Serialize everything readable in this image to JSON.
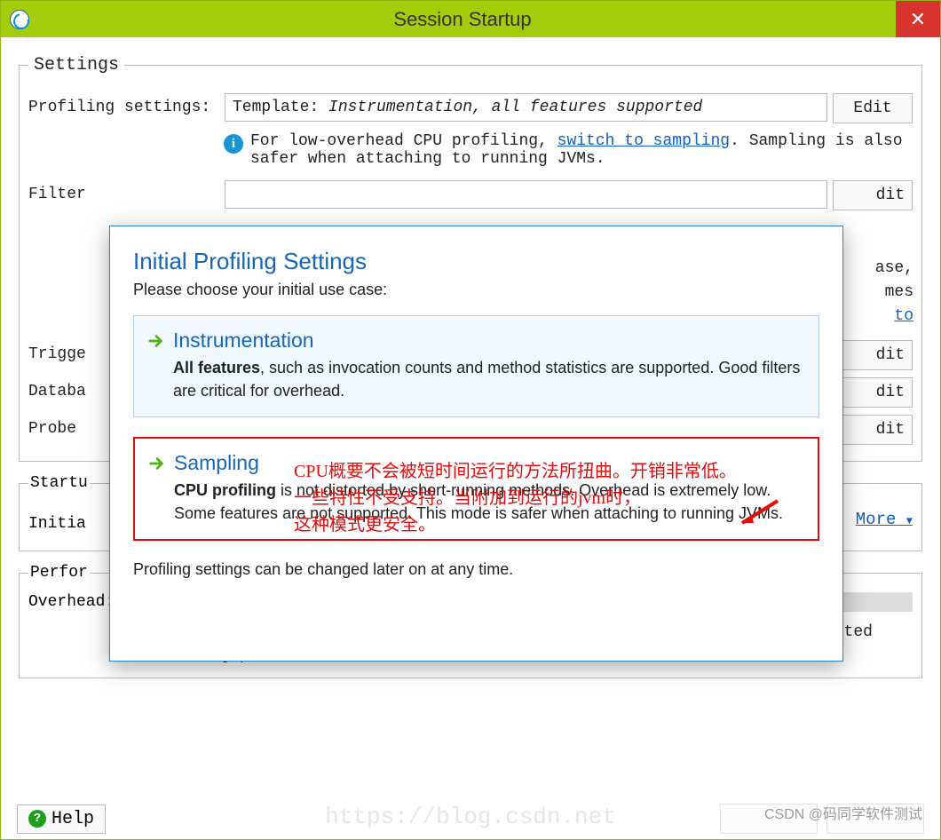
{
  "titlebar": {
    "title": "Session Startup",
    "close": "✕"
  },
  "settings": {
    "legend": "Settings",
    "rows": {
      "profiling": {
        "label": "Profiling settings:",
        "value_prefix": "Template: ",
        "value_italic": "Instrumentation, all features supported",
        "button": "Edit"
      },
      "info": {
        "pre": "For low-overhead CPU profiling, ",
        "link": "switch to sampling",
        "post": ". Sampling is also safer when attaching to running JVMs."
      },
      "filter": {
        "label": "Filter",
        "button_tail": "dit"
      },
      "filter_tail": {
        "line1_tail": "ase,",
        "line2_tail": "mes",
        "link_tail": " to"
      },
      "trigger": {
        "label": "Trigge",
        "button_tail": "dit"
      },
      "database": {
        "label": "Databa",
        "button_tail": "dit"
      },
      "probe": {
        "label": "Probe",
        "button_tail": "dit"
      }
    }
  },
  "startup": {
    "legend": "Startu",
    "row_label": "Initia",
    "more": "More"
  },
  "perform": {
    "legend": "Perfor",
    "overhead_label": "Overhead:",
    "desc": "The overhead is composed of the selected profiling settings and the selected recording profile."
  },
  "help": {
    "label": "Help"
  },
  "dialog": {
    "title": "Initial Profiling Settings",
    "sub": "Please choose your initial use case:",
    "instr": {
      "title": "Instrumentation",
      "body_bold": "All features",
      "body_rest": ", such as invocation counts and method statistics are supported. Good filters are critical for overhead."
    },
    "sampling": {
      "title": "Sampling",
      "body_bold": "CPU profiling",
      "body_rest": " is not distorted by short-running methods. Overhead is extremely low. Some features are not supported. This mode is safer when attaching to running JVMs."
    },
    "footer": "Profiling settings can be changed later on at any time."
  },
  "annotation": {
    "line1": "CPU概要不会被短时间运行的方法所扭曲。开销非常低。",
    "line2": "一些特性不受支持。当附加到运行的jvm时，",
    "line3": "这种模式更安全。"
  },
  "watermark": "CSDN @码同学软件测试",
  "bg_url": "https://blog.csdn.net"
}
